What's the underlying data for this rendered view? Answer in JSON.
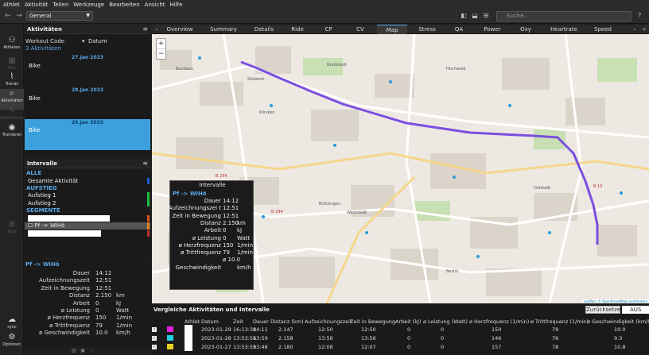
{
  "menu": [
    "Athlet",
    "Aktivität",
    "Teilen",
    "Werkzeuge",
    "Bearbeiten",
    "Ansicht",
    "Hilfe"
  ],
  "toolbar": {
    "workout": "General",
    "search_placeholder": "Suche..."
  },
  "sidebar": [
    {
      "label": "Athleten",
      "icon": "athlete-icon"
    },
    {
      "label": "Plan",
      "icon": "calendar-icon"
    },
    {
      "label": "Trends",
      "icon": "trends-icon"
    },
    {
      "label": "Aktivitäten",
      "icon": "search-icon"
    },
    {
      "label": "Aufzeichnen",
      "icon": "record-icon"
    },
    {
      "label": "Trainieren",
      "icon": "train-icon"
    },
    {
      "label": "Apps",
      "icon": "apps-icon"
    },
    {
      "label": "sync",
      "icon": "cloud-icon"
    },
    {
      "label": "Optionen",
      "icon": "gear-icon"
    }
  ],
  "activities": {
    "title": "Aktivitäten",
    "col_code": "Workout Code",
    "col_date": "Datum",
    "count": "3 Aktivitäten",
    "rows": [
      {
        "date": "27.Jan 2023",
        "code": "Bike"
      },
      {
        "date": "28.Jan 2023",
        "code": "Bike"
      },
      {
        "date": "29.Jan 2023",
        "code": "Bike"
      }
    ]
  },
  "intervals": {
    "title": "Intervalle",
    "rows": [
      {
        "label": "ALLE",
        "type": "group"
      },
      {
        "label": "Gesamte Aktivität",
        "type": "item"
      },
      {
        "label": "AUFSTIEG",
        "type": "group"
      },
      {
        "label": "Aufstieg 1",
        "type": "item"
      },
      {
        "label": "Aufstieg 2",
        "type": "item"
      },
      {
        "label": "SEGMENTE",
        "type": "group"
      },
      {
        "label": "",
        "type": "item"
      },
      {
        "label": "Pf -> WiHö",
        "type": "item"
      },
      {
        "label": "",
        "type": "item"
      }
    ]
  },
  "interval_stats": {
    "name": "Pf -> WiHö",
    "rows": [
      {
        "l": "Dauer",
        "v": "14:12",
        "u": ""
      },
      {
        "l": "Aufzeichnungszeit",
        "v": "12:51",
        "u": ""
      },
      {
        "l": "Zeit in Bewegung",
        "v": "12:51",
        "u": ""
      },
      {
        "l": "Distanz",
        "v": "2.150",
        "u": "km"
      },
      {
        "l": "Arbeit",
        "v": "0",
        "u": "kJ"
      },
      {
        "l": "ø Leistung",
        "v": "0",
        "u": "Watt"
      },
      {
        "l": "ø Herzfrequenz",
        "v": "150",
        "u": "1/min"
      },
      {
        "l": "ø Trittfrequenz",
        "v": "79",
        "u": "1/min"
      },
      {
        "l": "ø Geschwindigkeit",
        "v": "10.0",
        "u": "km/h"
      }
    ]
  },
  "tabs": [
    "Overview",
    "Summary",
    "Details",
    "Ride",
    "CP",
    "CV",
    "Map",
    "Stress",
    "QA",
    "Power",
    "Oxy",
    "Heartrate",
    "Speed"
  ],
  "active_tab": "Map",
  "map": {
    "zoom_in": "+",
    "zoom_out": "−",
    "attribution": "Leaflet | © OpenStreetMap contributors",
    "route_color": "#7b4fe0",
    "labels": [
      "Bauhaus",
      "Südwest",
      "Nordstadt",
      "Weststadt",
      "Hochwald",
      "Oststadt",
      "Bezirk",
      "Kliniken",
      "Brötzingen",
      "B 294",
      "B 10",
      "B 294"
    ]
  },
  "tooltip": {
    "title": "Intervalle",
    "name": "Pf -> WiHö",
    "rows": [
      {
        "l": "Dauer",
        "v": "14:12",
        "u": ""
      },
      {
        "l": "Aufzeichnungszei t",
        "v": "12:51",
        "u": ""
      },
      {
        "l": "Zeit in Bewegung",
        "v": "12:51",
        "u": ""
      },
      {
        "l": "Distanz",
        "v": "2.150",
        "u": "km"
      },
      {
        "l": "Arbeit",
        "v": "0",
        "u": "kJ"
      },
      {
        "l": "ø Leistung",
        "v": "0",
        "u": "Watt"
      },
      {
        "l": "ø Herzfrequenz",
        "v": "150",
        "u": "1/min"
      },
      {
        "l": "ø Trittfrequenz",
        "v": "79",
        "u": "1/min"
      },
      {
        "l": "",
        "v": "ø 10.0",
        "u": ""
      },
      {
        "l": "Geschwindigkeit",
        "v": "",
        "u": "km/h"
      }
    ]
  },
  "compare": {
    "title": "Vergleiche Aktivitäten und Intervalle",
    "reset": "Zurücksetzen",
    "toggle": "AUS",
    "headers": [
      "Athlet",
      "Datum",
      "Zeit",
      "Dauer",
      "Distanz (km)",
      "Aufzeichnungszeit",
      "Zeit in Bewegung",
      "Arbeit (kJ)",
      "ø Leistung (Watt)",
      "ø Herzfrequenz (1/min)",
      "ø Trittfrequenz (1/min)",
      "ø Geschwindigkeit (km/h)"
    ],
    "rows": [
      {
        "color": "#e020e0",
        "cells": [
          "",
          "2023-01-29",
          "16:13:38",
          "14:11",
          "2.147",
          "12:50",
          "12:50",
          "0",
          "0",
          "150",
          "79",
          "10.0"
        ]
      },
      {
        "color": "#20d0e0",
        "cells": [
          "",
          "2023-01-28",
          "13:53:56",
          "13:59",
          "2.158",
          "13:56",
          "13:56",
          "0",
          "0",
          "146",
          "76",
          "9.3"
        ]
      },
      {
        "color": "#e8d020",
        "cells": [
          "",
          "2023-01-27",
          "13:53:59",
          "13:48",
          "2.180",
          "12:08",
          "12:07",
          "0",
          "0",
          "157",
          "78",
          "10.8"
        ]
      }
    ]
  }
}
